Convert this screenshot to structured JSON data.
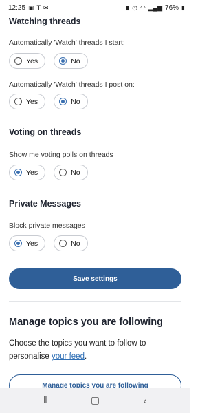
{
  "status_bar": {
    "time": "12:25",
    "left_icons": [
      "image-icon",
      "t-icon",
      "mail-icon"
    ],
    "battery": "76%"
  },
  "watching": {
    "title": "Watching threads",
    "q1": {
      "label": "Automatically 'Watch' threads I start:",
      "options": [
        "Yes",
        "No"
      ],
      "selected": "No"
    },
    "q2": {
      "label": "Automatically 'Watch' threads I post on:",
      "options": [
        "Yes",
        "No"
      ],
      "selected": "No"
    }
  },
  "voting": {
    "title": "Voting on threads",
    "q1": {
      "label": "Show me voting polls on threads",
      "options": [
        "Yes",
        "No"
      ],
      "selected": "Yes"
    }
  },
  "private_messages": {
    "title": "Private Messages",
    "q1": {
      "label": "Block private messages",
      "options": [
        "Yes",
        "No"
      ],
      "selected": "Yes"
    }
  },
  "save_label": "Save settings",
  "topics": {
    "title": "Manage topics you are following",
    "text_before": "Choose the topics you want to follow to personalise ",
    "link_text": "your feed",
    "text_after": ".",
    "button_label": "Manage topics you are following"
  },
  "colors": {
    "primary": "#2f5f98",
    "radio_accent": "#3a6fb0",
    "link": "#2f6fb5"
  }
}
